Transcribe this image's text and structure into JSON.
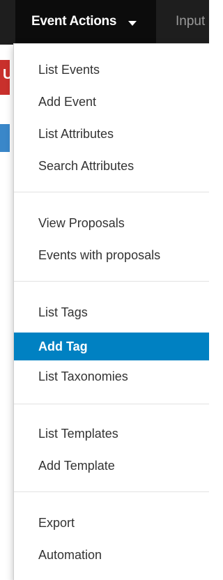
{
  "navbar": {
    "active_menu": "Event Actions",
    "next_menu": "Input"
  },
  "background_fragments": {
    "red_badge": "U"
  },
  "menu": {
    "items": [
      {
        "label": "List Events"
      },
      {
        "label": "Add Event"
      },
      {
        "label": "List Attributes"
      },
      {
        "label": "Search Attributes"
      },
      {
        "label": "View Proposals"
      },
      {
        "label": "Events with proposals"
      },
      {
        "label": "List Tags"
      },
      {
        "label": "Add Tag",
        "highlighted": true
      },
      {
        "label": "List Taxonomies"
      },
      {
        "label": "List Templates"
      },
      {
        "label": "Add Template"
      },
      {
        "label": "Export"
      },
      {
        "label": "Automation"
      }
    ]
  },
  "colors": {
    "navbar": "#1e1e1e",
    "highlight": "#0081c2",
    "badge_red": "#c9302c"
  }
}
